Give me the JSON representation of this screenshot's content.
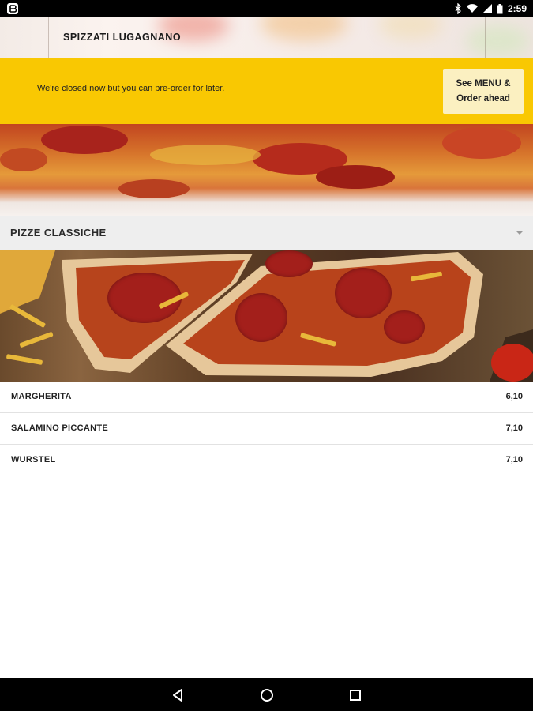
{
  "status_bar": {
    "time": "2:59",
    "icons": [
      "app-notification-icon",
      "bluetooth-icon",
      "wifi-icon",
      "signal-icon",
      "battery-icon"
    ]
  },
  "header": {
    "title": "SPIZZATI LUGAGNANO"
  },
  "notice": {
    "message": "We're closed now but you can pre-order for later.",
    "button_label": "See MENU &\nOrder ahead"
  },
  "section": {
    "title": "PIZZE CLASSICHE",
    "icon": "chevron-down-icon"
  },
  "menu": {
    "items": [
      {
        "name": "MARGHERITA",
        "price": "6,10"
      },
      {
        "name": "SALAMINO PICCANTE",
        "price": "7,10"
      },
      {
        "name": "WURSTEL",
        "price": "7,10"
      }
    ]
  },
  "nav_bar": {
    "icons": [
      "back-icon",
      "home-icon",
      "recents-icon"
    ]
  },
  "colors": {
    "banner": "#f9c802",
    "banner_button": "#fbf0c1",
    "section_bg": "#eeeeee"
  }
}
